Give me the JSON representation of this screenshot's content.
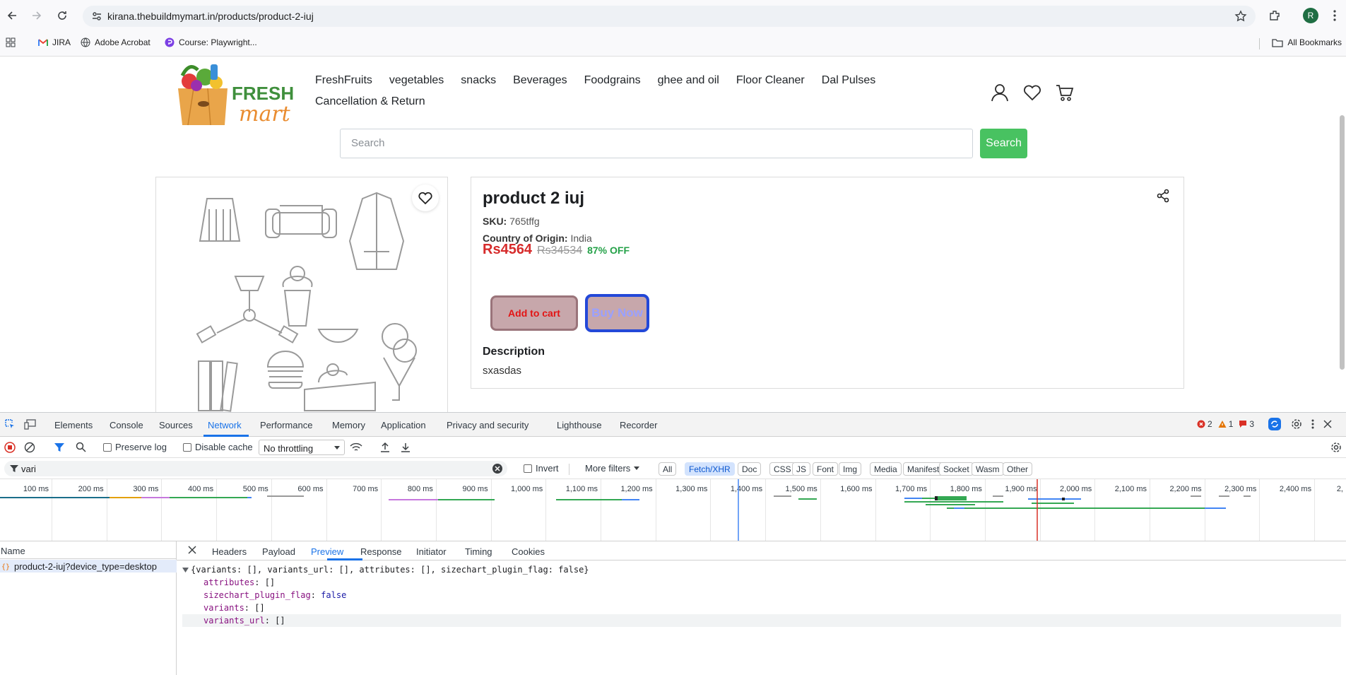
{
  "browser": {
    "url": "kirana.thebuildmymart.in/products/product-2-iuj",
    "profile_initial": "R",
    "bookmarks": [
      {
        "label": "JIRA",
        "icon": "gmail-icon"
      },
      {
        "label": "Adobe Acrobat",
        "icon": "globe-icon"
      },
      {
        "label": "Course: Playwright...",
        "icon": "course-icon"
      }
    ],
    "all_bookmarks": "All Bookmarks"
  },
  "site": {
    "logo": {
      "line1": "FRESH",
      "line2": "mart"
    },
    "nav_row1": [
      "FreshFruits",
      "vegetables",
      "snacks",
      "Beverages",
      "Foodgrains",
      "ghee and oil",
      "Floor Cleaner",
      "Dal Pulses"
    ],
    "nav_row2": [
      "Cancellation & Return"
    ],
    "search_placeholder": "Search",
    "search_button": "Search"
  },
  "product": {
    "title": "product 2 iuj",
    "sku_label": "SKU:",
    "sku": "765tffg",
    "origin_label": "Country of Origin:",
    "origin": "India",
    "price": "Rs4564",
    "mrp": "Rs34534",
    "discount": "87% OFF",
    "add_to_cart": "Add to cart",
    "buy_now": "Buy Now",
    "description_heading": "Description",
    "description": "sxasdas"
  },
  "devtools": {
    "tabs": [
      "Elements",
      "Console",
      "Sources",
      "Network",
      "Performance",
      "Memory",
      "Application",
      "Privacy and security",
      "Lighthouse",
      "Recorder"
    ],
    "active_tab": "Network",
    "errors": "2",
    "warnings": "1",
    "issues": "3",
    "toolbar": {
      "preserve_log": "Preserve log",
      "disable_cache": "Disable cache",
      "throttling": "No throttling"
    },
    "filter": {
      "value": "vari",
      "invert": "Invert",
      "more_filters": "More filters",
      "types": [
        "All",
        "Fetch/XHR",
        "Doc",
        "CSS",
        "JS",
        "Font",
        "Img",
        "Media",
        "Manifest",
        "Socket",
        "Wasm",
        "Other"
      ],
      "active_type": "Fetch/XHR"
    },
    "timeline_ticks": [
      "100 ms",
      "200 ms",
      "300 ms",
      "400 ms",
      "500 ms",
      "600 ms",
      "700 ms",
      "800 ms",
      "900 ms",
      "1,000 ms",
      "1,100 ms",
      "1,200 ms",
      "1,300 ms",
      "1,400 ms",
      "1,500 ms",
      "1,600 ms",
      "1,700 ms",
      "1,800 ms",
      "1,900 ms",
      "2,000 ms",
      "2,100 ms",
      "2,200 ms",
      "2,300 ms",
      "2,400 ms",
      "2,"
    ],
    "name_header": "Name",
    "request_name": "product-2-iuj?device_type=desktop",
    "detail_tabs": [
      "Headers",
      "Payload",
      "Preview",
      "Response",
      "Initiator",
      "Timing",
      "Cookies"
    ],
    "active_detail_tab": "Preview",
    "preview": {
      "summary": "{variants: [], variants_url: [], attributes: [], sizechart_plugin_flag: false}",
      "rows": [
        {
          "key": "attributes",
          "value": "[]",
          "type": "array"
        },
        {
          "key": "sizechart_plugin_flag",
          "value": "false",
          "type": "bool"
        },
        {
          "key": "variants",
          "value": "[]",
          "type": "array"
        },
        {
          "key": "variants_url",
          "value": "[]",
          "type": "array"
        }
      ]
    }
  },
  "colors": {
    "accent": "#1a73e8",
    "search_button": "#48c261",
    "price": "#d62b2b",
    "discount": "#24a148"
  }
}
